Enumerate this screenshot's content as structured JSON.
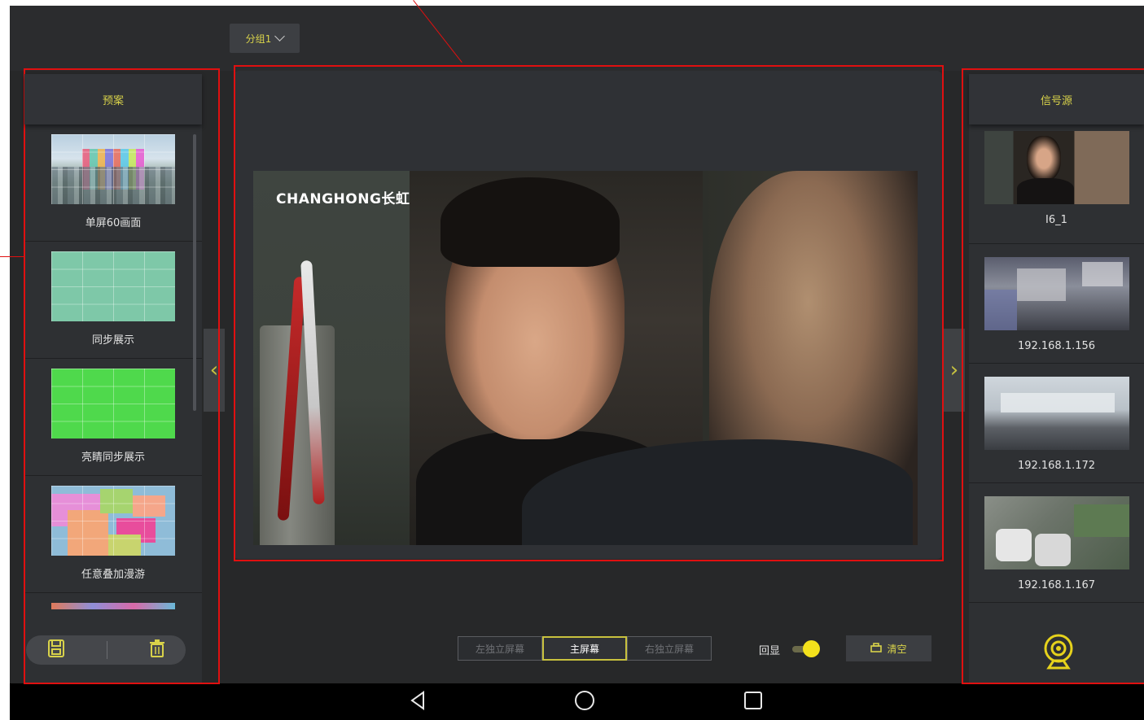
{
  "topbar": {
    "group_label": "分组1"
  },
  "left_panel": {
    "title": "预案",
    "items": [
      {
        "label": "单屏60画面"
      },
      {
        "label": "同步展示"
      },
      {
        "label": "亮睛同步展示"
      },
      {
        "label": "任意叠加漫游"
      }
    ],
    "save_icon": "save-icon",
    "delete_icon": "trash-icon"
  },
  "center": {
    "logo_text": "CHANGHONG长虹",
    "screen_tabs": [
      "左独立屏幕",
      "主屏幕",
      "右独立屏幕"
    ],
    "active_tab": 1,
    "echo_label": "回显",
    "echo_on": true,
    "clear_label": "清空"
  },
  "right_panel": {
    "title": "信号源",
    "items": [
      {
        "label": "I6_1"
      },
      {
        "label": "192.168.1.156"
      },
      {
        "label": "192.168.1.172"
      },
      {
        "label": "192.168.1.167"
      }
    ],
    "camera_icon": "webcam-icon"
  },
  "nav": {
    "back_icon": "back-icon",
    "home_icon": "home-icon",
    "recents_icon": "recents-icon"
  },
  "colors": {
    "accent": "#d8d24a",
    "annotation": "#e01010",
    "background": "#272829"
  }
}
